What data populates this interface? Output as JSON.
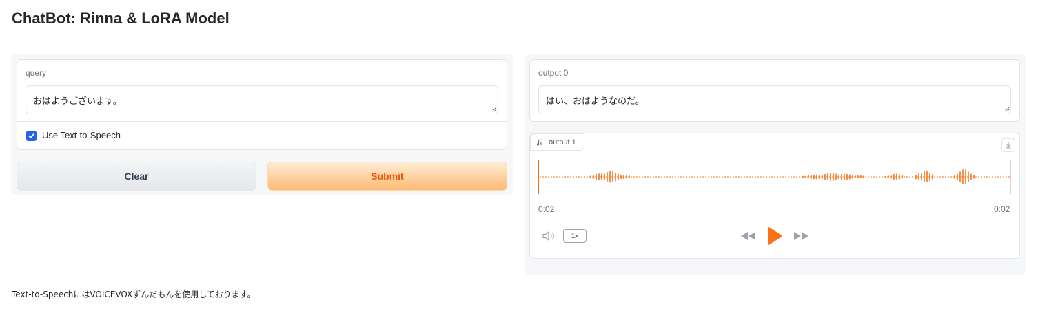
{
  "app": {
    "title": "ChatBot: Rinna & LoRA Model"
  },
  "inputs": {
    "query_label": "query",
    "query_value": "おはようございます。",
    "tts_checkbox_label": "Use Text-to-Speech",
    "tts_checked": true
  },
  "buttons": {
    "clear_label": "Clear",
    "submit_label": "Submit"
  },
  "outputs": {
    "output0_label": "output 0",
    "output0_value": "はい、おはようなのだ。",
    "output1_label": "output 1"
  },
  "audio": {
    "current_time": "0:02",
    "duration": "0:02",
    "speed": "1x",
    "progress": 0,
    "waveform_color": "#f97316"
  },
  "footer": {
    "note": "Text-to-SpeechにはVOICEVOXずんだもんを使用しております。"
  },
  "colors": {
    "accent": "#f97316",
    "checkbox": "#2563eb"
  },
  "icons": {
    "music": "music-note-icon",
    "download": "download-icon",
    "volume": "volume-icon",
    "rewind": "rewind-icon",
    "play": "play-icon",
    "forward": "fast-forward-icon"
  }
}
